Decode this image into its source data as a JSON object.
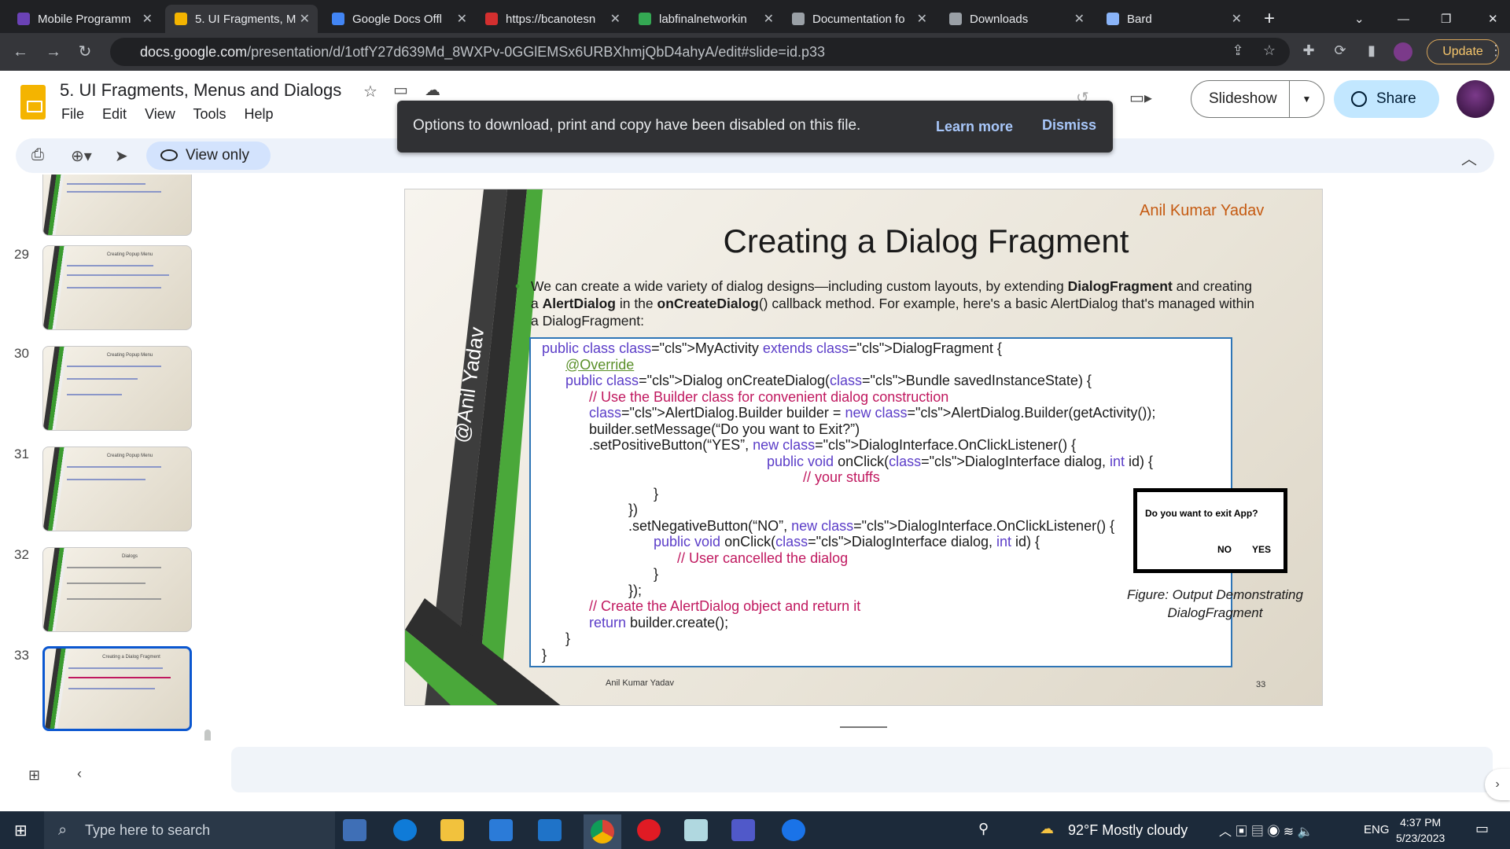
{
  "browser": {
    "tabs": [
      {
        "title": "Mobile Programm",
        "color": "#6b42b6"
      },
      {
        "title": "5. UI Fragments, M",
        "color": "#f4b400",
        "active": true
      },
      {
        "title": "Google Docs Offl",
        "color": "#4285f4"
      },
      {
        "title": "https://bcanotesn",
        "color": "#d32f2f"
      },
      {
        "title": "labfinalnetworkin",
        "color": "#34a853"
      },
      {
        "title": "Documentation fo",
        "color": "#9aa0a6"
      },
      {
        "title": "Downloads",
        "color": "#9aa0a6"
      },
      {
        "title": "Bard",
        "color": "#8ab4f8"
      }
    ],
    "url_host": "docs.google.com",
    "url_path": "/presentation/d/1otfY27d639Md_8WXPv-0GGlEMSx6URBXhmjQbD4ahyA/edit#slide=id.p33",
    "update_label": "Update"
  },
  "app": {
    "title": "5. UI Fragments, Menus and Dialogs",
    "menus": [
      "File",
      "Edit",
      "View",
      "Tools",
      "Help"
    ],
    "slideshow_label": "Slideshow",
    "share_label": "Share",
    "view_only_label": "View only"
  },
  "toast": {
    "message": "Options to download, print and copy have been disabled on this file.",
    "learn_more": "Learn more",
    "dismiss": "Dismiss"
  },
  "filmstrip": {
    "numbers": [
      "29",
      "30",
      "31",
      "32",
      "33"
    ],
    "titles": [
      "Creating Popup Menu",
      "Creating Popup Menu",
      "Creating Popup Menu",
      "Dialogs",
      "Creating a Dialog Fragment"
    ]
  },
  "slide": {
    "author_top": "Anil Kumar Yadav",
    "vertical_text": "@Anil Yadav",
    "title": "Creating a Dialog Fragment",
    "bullet_html_parts": [
      "We can create a wide variety of dialog designs—including custom layouts, by extending ",
      "DialogFragment",
      " and creating a ",
      "AlertDialog",
      " in the ",
      "onCreateDialog",
      "() callback method. For example, here's a basic AlertDialog that's managed within a DialogFragment:"
    ],
    "code_lines": [
      "public class MyActivity extends DialogFragment {",
      "@Override",
      "public Dialog onCreateDialog(Bundle savedInstanceState) {",
      "// Use the Builder class for convenient dialog construction",
      "AlertDialog.Builder builder = new AlertDialog.Builder(getActivity());",
      "builder.setMessage(“Do you want to Exit?”)",
      ".setPositiveButton(“YES”, new DialogInterface.OnClickListener() {",
      "public void onClick(DialogInterface dialog, int id) {",
      "// your stuffs",
      "}",
      "})",
      ".setNegativeButton(“NO”, new DialogInterface.OnClickListener() {",
      "public void onClick(DialogInterface dialog, int id) {",
      "// User cancelled the dialog",
      "}",
      "});",
      "// Create the AlertDialog object and return it",
      "return builder.create();",
      "}",
      "}"
    ],
    "dialog": {
      "question": "Do you want to exit App?",
      "no": "NO",
      "yes": "YES"
    },
    "caption": "Figure: Output Demonstrating DialogFragment",
    "footer_name": "Anil Kumar Yadav",
    "footer_number": "33"
  },
  "taskbar": {
    "search_placeholder": "Type here to search",
    "weather": "92°F  Mostly cloudy",
    "language": "ENG",
    "time": "4:37 PM",
    "date": "5/23/2023"
  }
}
